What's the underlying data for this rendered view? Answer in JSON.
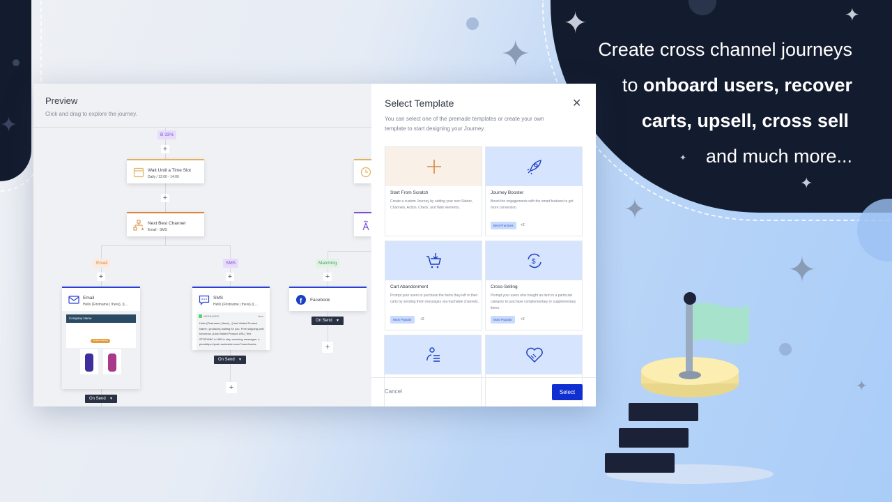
{
  "tagline": {
    "line1": "Create cross channel journeys",
    "line2_pre": "to ",
    "line2_bold": "onboard users, recover",
    "line3_bold": "carts, upsell, cross sell",
    "line4": "and much more..."
  },
  "preview": {
    "title": "Preview",
    "subtitle": "Click and drag to explore the journey.",
    "split_badge": "B 33%",
    "wait_node": {
      "title": "Wait Until a Time Slot",
      "subtitle": "Daily / 12:00 - 14:00",
      "icon": "calendar-icon"
    },
    "nbc_node": {
      "title": "Next Best Channel",
      "subtitle": "Email - SMS",
      "icon": "hierarchy-icon"
    },
    "branches": [
      "Email",
      "SMS",
      "Matching"
    ],
    "email_node": {
      "title": "Email",
      "subtitle": "Hello {Firstname | there}, {L...",
      "preview_company": "Company Name",
      "preview_button": "Continue Shopping"
    },
    "sms_node": {
      "title": "SMS",
      "subtitle": "Hello {Firstname | there} {L...",
      "app": "MESSAGES",
      "time": "Now",
      "body": "Hello {Firstname | there} , {Last Visited Product Name | products} waiting for you. Free shipping until tomorrow. {Last Visited Product URL} Text STOP/ABC to 555 to stop receiving messages. o ptouthttps://posh.useinsider.com/?smsUnsubs"
    },
    "facebook_node": {
      "title": "Facebook"
    },
    "on_send": "On Send",
    "colors": {
      "wait": "#e0b25b",
      "nbc": "#d9883a",
      "channel": "#2a3fd6",
      "ab": "#7b4fd6"
    }
  },
  "modal": {
    "title": "Select Template",
    "description": "You can select one of the premade templates or create your own template to start designing your Journey.",
    "templates": [
      {
        "name": "Start From Scratch",
        "description": "Create a custom Journey by adding your own Starter, Channels, Action, Check, and Wait elements.",
        "icon": "plus-icon"
      },
      {
        "name": "Journey Booster",
        "description": "Boost the engagements with the smart features to get more conversion.",
        "badge": "Best Practices",
        "more": "+2",
        "icon": "rocket-icon"
      },
      {
        "name": "Cart Abandonment",
        "description": "Prompt your users to purchase the items they left in their carts by sending them messages via reachable channels.",
        "badge": "Most Popular",
        "more": "+2",
        "icon": "cart-icon"
      },
      {
        "name": "Cross-Selling",
        "description": "Prompt your users who bought an item in a particular category to purchase complementary or supplementary items.",
        "badge": "Most Popular",
        "more": "+2",
        "icon": "exchange-dollar-icon"
      },
      {
        "icon": "user-list-icon"
      },
      {
        "icon": "handshake-heart-icon"
      }
    ],
    "cancel": "Cancel",
    "select": "Select",
    "accent": "#0f2fd0"
  }
}
